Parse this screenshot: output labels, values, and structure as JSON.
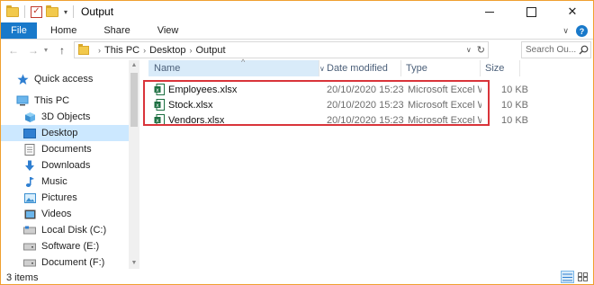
{
  "window": {
    "title": "Output"
  },
  "ribbon": {
    "tabs": [
      "File",
      "Home",
      "Share",
      "View"
    ]
  },
  "address": {
    "crumbs": [
      "This PC",
      "Desktop",
      "Output"
    ]
  },
  "search": {
    "placeholder": "Search Ou..."
  },
  "nav": {
    "items": [
      {
        "label": "Quick access",
        "icon": "star-icon"
      },
      {
        "label": "This PC",
        "icon": "computer-icon"
      },
      {
        "label": "3D Objects",
        "icon": "cube-icon"
      },
      {
        "label": "Desktop",
        "icon": "desktop-icon",
        "selected": true
      },
      {
        "label": "Documents",
        "icon": "document-icon"
      },
      {
        "label": "Downloads",
        "icon": "download-icon"
      },
      {
        "label": "Music",
        "icon": "music-icon"
      },
      {
        "label": "Pictures",
        "icon": "picture-icon"
      },
      {
        "label": "Videos",
        "icon": "video-icon"
      },
      {
        "label": "Local Disk (C:)",
        "icon": "drive-icon"
      },
      {
        "label": "Software (E:)",
        "icon": "drive-icon"
      },
      {
        "label": "Document (F:)",
        "icon": "drive-icon"
      }
    ]
  },
  "columns": {
    "name": "Name",
    "date": "Date modified",
    "type": "Type",
    "size": "Size"
  },
  "files": [
    {
      "name": "Employees.xlsx",
      "date": "20/10/2020 15:23",
      "type": "Microsoft Excel W...",
      "size": "10 KB"
    },
    {
      "name": "Stock.xlsx",
      "date": "20/10/2020 15:23",
      "type": "Microsoft Excel W...",
      "size": "10 KB"
    },
    {
      "name": "Vendors.xlsx",
      "date": "20/10/2020 15:23",
      "type": "Microsoft Excel W...",
      "size": "10 KB"
    }
  ],
  "status": {
    "count": "3 items"
  },
  "colors": {
    "accent": "#1979ca",
    "selection": "#cce8ff",
    "highlight_border": "#d9343a",
    "excel_green": "#1d6f42"
  }
}
